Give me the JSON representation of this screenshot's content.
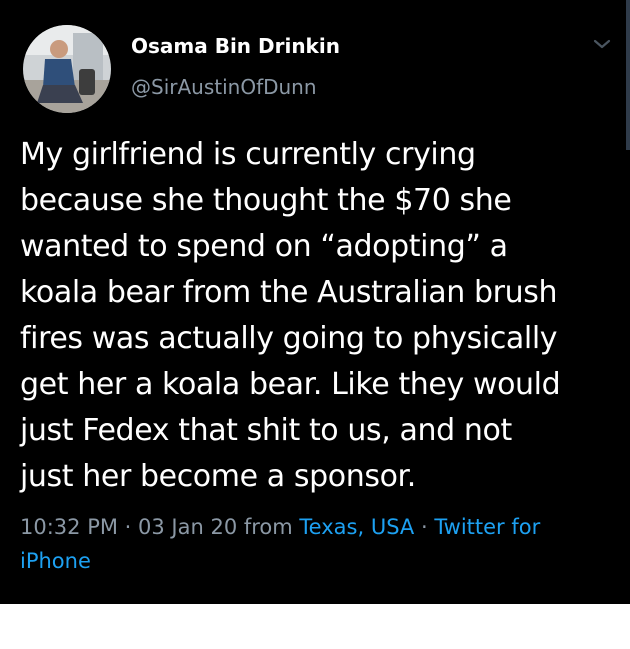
{
  "author": {
    "display_name": "Osama Bin Drinkin",
    "handle": "@SirAustinOfDunn",
    "avatar_icon": "user-avatar"
  },
  "menu": {
    "icon": "chevron-down-icon"
  },
  "tweet": {
    "lines": [
      "My girlfriend is currently crying",
      "because she thought the $70 she",
      "wanted to spend on “adopting” a",
      "koala bear from the Australian brush",
      "fires was actually going to physically",
      "get her a koala bear. Like they would",
      "just Fedex that shit to us, and not",
      "just her become a sponsor."
    ]
  },
  "meta": {
    "time": "10:32 PM",
    "separator": " · ",
    "date": "03 Jan 20",
    "from_label": " from ",
    "location": "Texas, USA",
    "source_line1": "Twitter for",
    "source_line2": "iPhone"
  },
  "colors": {
    "background": "#000000",
    "text": "#ffffff",
    "muted": "#8b98a5",
    "link": "#1da1f2"
  }
}
